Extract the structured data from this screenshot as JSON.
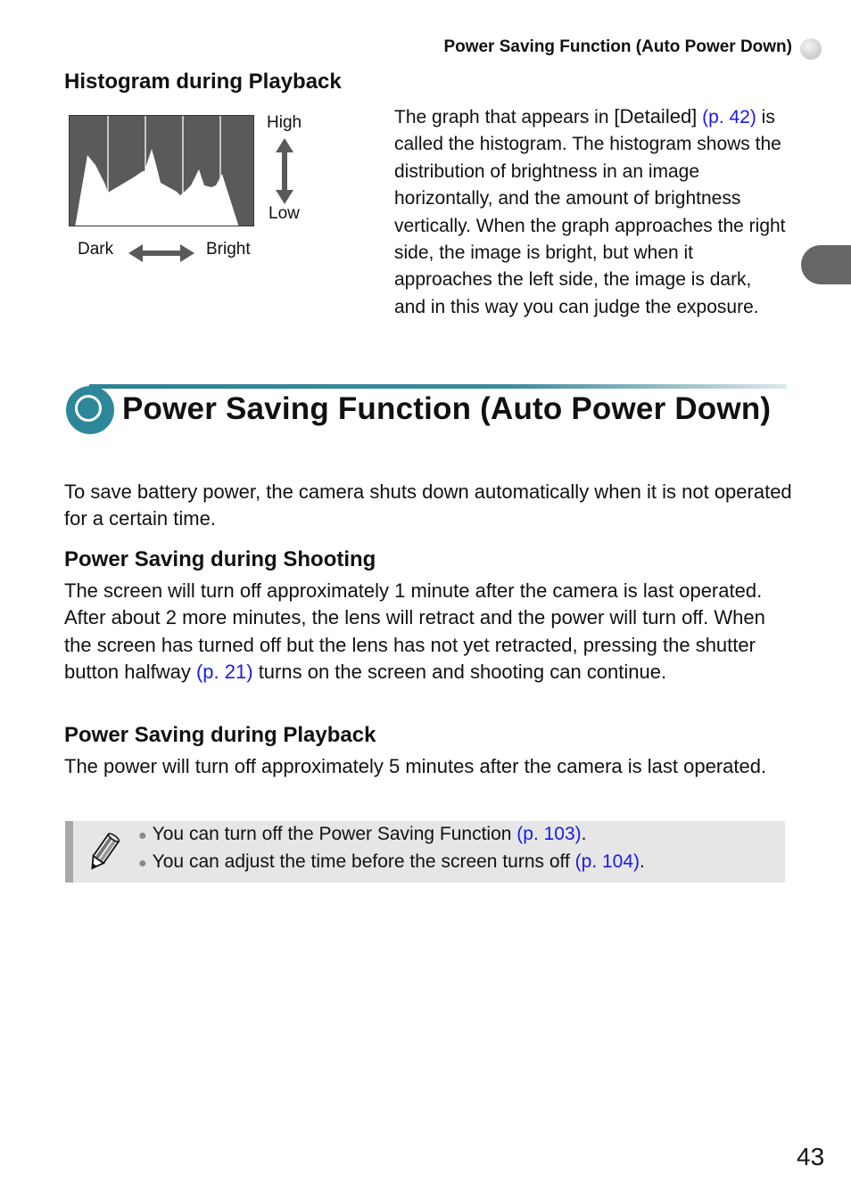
{
  "running_head": {
    "title": "Power Saving Function (Auto Power Down)"
  },
  "histogram_section": {
    "heading": "Histogram during Playback",
    "figure": {
      "high_label": "High",
      "low_label": "Low",
      "dark_label": "Dark",
      "bright_label": "Bright",
      "colors": {
        "fill": "#5a5a5a",
        "histogram": "#ffffff",
        "arrow": "#5a5a5a"
      }
    },
    "description": {
      "before": "The graph that appears in ",
      "detailed": "[Detailed]",
      "link": "(p. 42)",
      "after": " is called the histogram. The histogram shows the distribution of brightness in an image horizontally, and the amount of brightness vertically. When the graph approaches the right side, the image is bright, but when it approaches the left side, the image is dark, and in this way you can judge the exposure."
    }
  },
  "main_section": {
    "title": "Power Saving Function (Auto Power Down)",
    "accent_color": "#2e8799",
    "intro": "To save battery power, the camera shuts down automatically when it is not operated for a certain time.",
    "shooting": {
      "heading": "Power Saving during Shooting",
      "text_before": "The screen will turn off approximately 1 minute after the camera is last operated. After about 2 more minutes, the lens will retract and the power will turn off. When the screen has turned off but the lens has not yet retracted, pressing the shutter button halfway ",
      "link": "(p. 21)",
      "text_after": " turns on the screen and shooting can continue."
    },
    "playback": {
      "heading": "Power Saving during Playback",
      "text": "The power will turn off approximately 5 minutes after the camera is last operated."
    }
  },
  "note": {
    "icon": "pencil-icon",
    "items": [
      {
        "text": "You can turn off the Power Saving Function ",
        "link": "(p. 103)",
        "end": "."
      },
      {
        "text": "You can adjust the time before the screen turns off ",
        "link": "(p. 104)",
        "end": "."
      }
    ]
  },
  "page_number": "43",
  "link_color": "#1a1ae6"
}
